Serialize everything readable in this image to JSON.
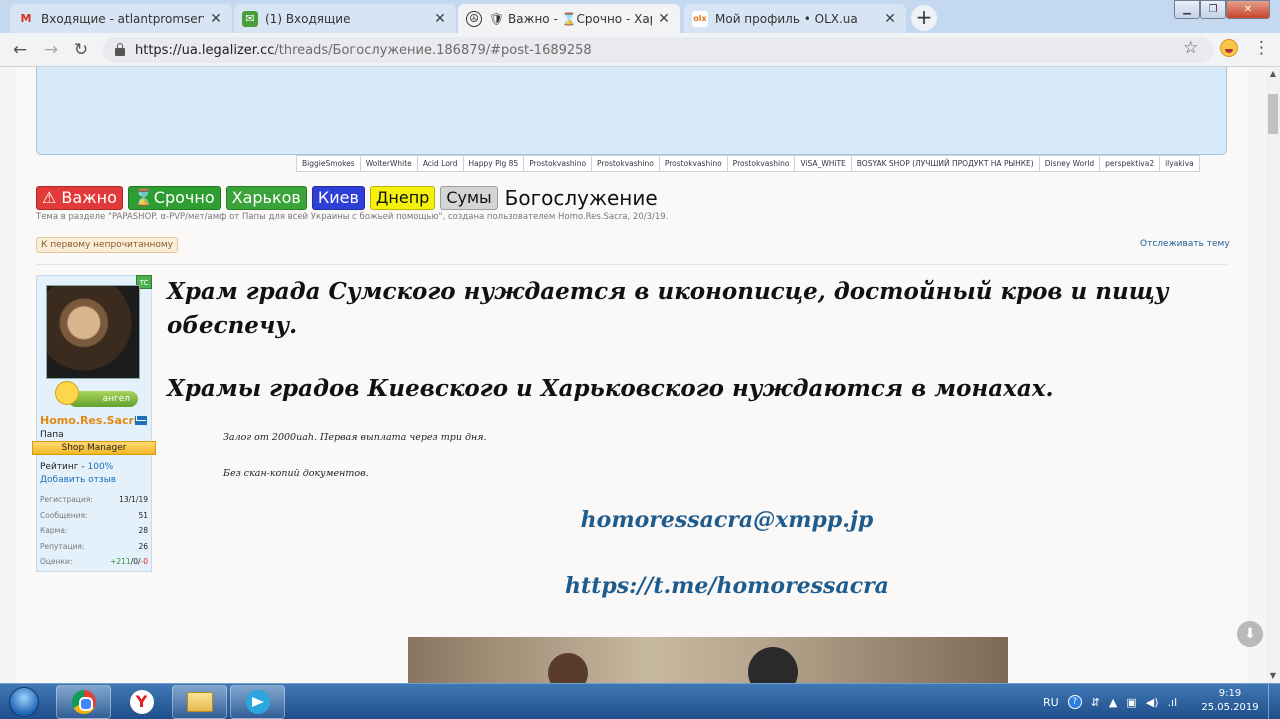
{
  "browser": {
    "tabs": [
      {
        "favicon": "gmail-icon",
        "label": "Входящие - atlantpromservis@g",
        "active": false
      },
      {
        "favicon": "mail-icon",
        "label": "(1) Входящие",
        "active": false
      },
      {
        "favicon": "peace-icon",
        "label": "🛡 Важно - ⌛Срочно - Харьков -",
        "active": true
      },
      {
        "favicon": "olx-icon",
        "label": "Мой профиль • OLX.ua",
        "active": false
      }
    ],
    "new_tab": "+",
    "url_host": "https://ua.legalizer.cc",
    "url_path": "/threads/Богослужение.186879/#post-1689258"
  },
  "forum": {
    "usernames": [
      "BiggieSmokes",
      "WolterWhite",
      "Acid Lord",
      "Happy Pig 85",
      "Prostokvashino",
      "Prostokvashino",
      "Prostokvashino",
      "Prostokvashino",
      "ViSA_WHiTE",
      "BOSYAK SHOP (ЛУЧШИЙ ПРОДУКТ НА РЫНКЕ)",
      "Disney World",
      "perspektiva2",
      "ilyakiva"
    ],
    "prefixes": [
      {
        "label": "⚠ Важно",
        "style": "red"
      },
      {
        "label": "⌛Срочно",
        "style": "green"
      },
      {
        "label": "Харьков",
        "style": "green2"
      },
      {
        "label": "Киев",
        "style": "blue"
      },
      {
        "label": "Днепр",
        "style": "yellow"
      },
      {
        "label": "Сумы",
        "style": "gray"
      }
    ],
    "thread_title": "Богослужение",
    "meta": "Тема в разделе \"PAPASHOP. α-PVP/мет/амф от Папы для всей Украины с божьей помощью\", создана пользователем Homo.Res.Sacra, 20/3/19.",
    "first_unread": "К первому непрочитанному",
    "watch": "Отслеживать тему"
  },
  "user": {
    "badge_tc": "TC",
    "angel": "ангел",
    "name": "Homo.Res.Sacra",
    "title": "Папа",
    "role": "Shop Manager",
    "rating_label": "Рейтинг - ",
    "rating_value": "100%",
    "add_review": "Добавить отзыв",
    "stats": [
      {
        "label": "Регистрация:",
        "value": "13/1/19"
      },
      {
        "label": "Сообщения:",
        "value": "51"
      },
      {
        "label": "Карма:",
        "value": "28"
      },
      {
        "label": "Репутация:",
        "value": "26"
      }
    ],
    "votes_label": "Оценки:",
    "votes_pos": "+211",
    "votes_zero": "/0/",
    "votes_neg": "-0"
  },
  "post": {
    "headline1": "Храм града Сумского нуждается в иконописце, достойный кров и пищу обеспечу.",
    "headline2": "Храмы градов Киевского и Харьковского нуждаются в монахах.",
    "line1": "Залог от 2000uah. Первая выплата через три дня.",
    "line2": "Без скан-копий документов.",
    "contact1": "homoressacra@xmpp.jp",
    "contact2": "https://t.me/homoressacra"
  },
  "taskbar": {
    "lang": "RU",
    "time": "9:19",
    "date": "25.05.2019"
  },
  "colors": {
    "accent_link": "#1f5c8e",
    "username": "#e08a14"
  }
}
